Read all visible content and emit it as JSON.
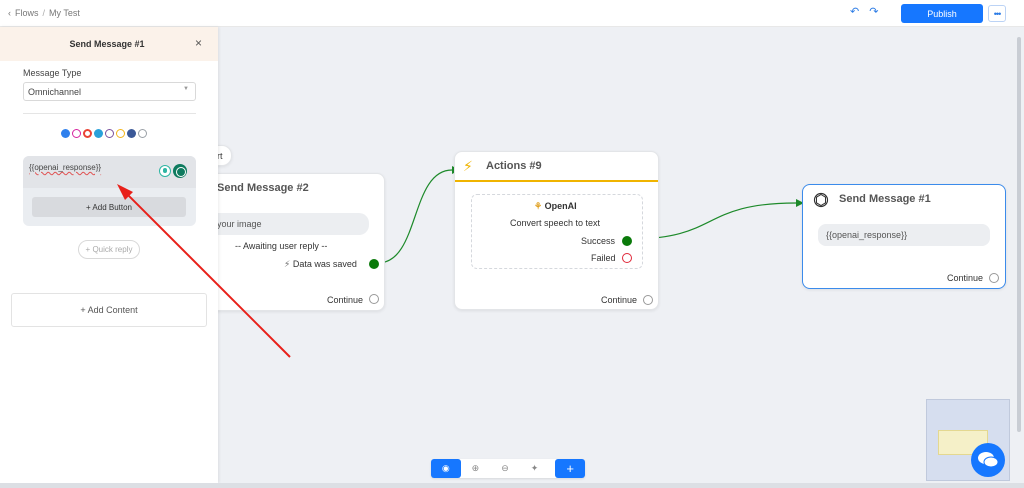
{
  "topbar": {
    "crumb_root": "Flows",
    "crumb_sep": "/",
    "crumb_current": "My Test",
    "undo_icon": "undo-icon",
    "redo_icon": "redo-icon",
    "publish_label": "Publish",
    "more_label": "•••",
    "back_icon": "chevron-left-icon"
  },
  "panel": {
    "title": "Send Message #1",
    "close": "×",
    "message_type_label": "Message Type",
    "message_type_value": "Omnichannel",
    "channel_icons": [
      "messenger",
      "instagram",
      "google",
      "telegram",
      "viber",
      "sms",
      "whatsapp",
      "chat"
    ],
    "message_text": "{{openai_response}}",
    "add_button_label": "+ Add Button",
    "quick_reply_label": "+ Quick reply",
    "add_content_label": "+ Add Content"
  },
  "nodes": {
    "start_partial": "rt",
    "send_message_2": {
      "title": "Send Message #2",
      "pill_text": "t your image",
      "awaiting": "-- Awaiting user reply --",
      "saved": "Data was saved",
      "continue": "Continue"
    },
    "actions_9": {
      "title": "Actions #9",
      "provider": "OpenAI",
      "action": "Convert speech to text",
      "success": "Success",
      "failed": "Failed",
      "continue": "Continue"
    },
    "send_message_1": {
      "title": "Send Message #1",
      "pill_text": "{{openai_response}}",
      "continue": "Continue"
    }
  },
  "toolbar": {
    "plus": "+"
  },
  "colors": {
    "accent": "#1677ff",
    "success_port": "#0a7a0a",
    "failed_port": "#e0283a",
    "actions_border": "#f0b400",
    "selected_node_border": "#3b8beb",
    "arrow": "#e8201a"
  }
}
